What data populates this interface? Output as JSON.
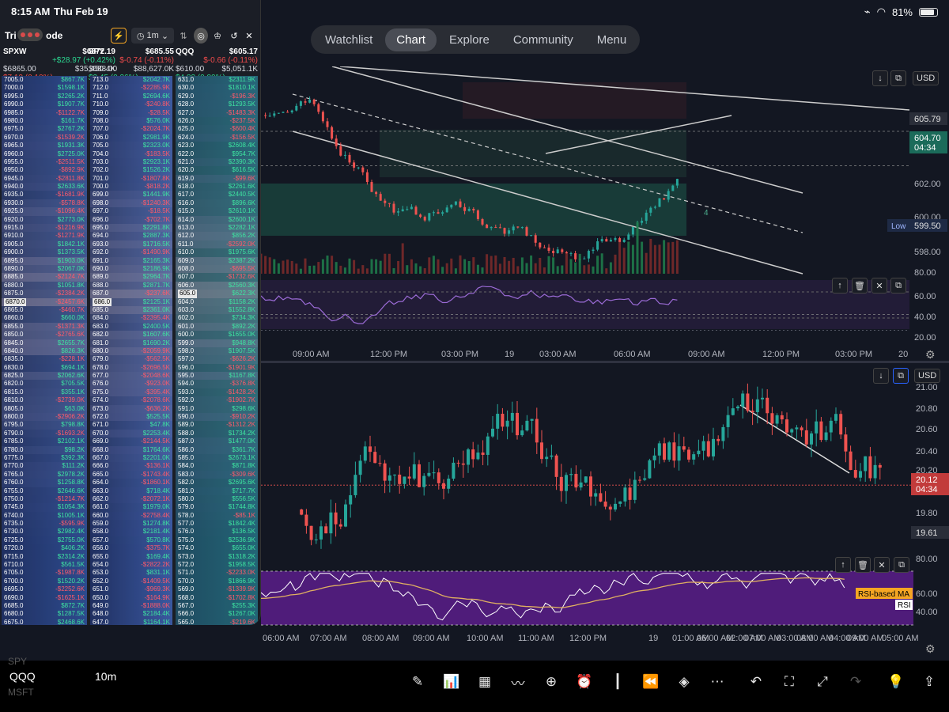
{
  "status": {
    "time": "8:15 AM",
    "date": "Thu Feb 19",
    "battery": "81%"
  },
  "tabs": [
    "Watchlist",
    "Chart",
    "Explore",
    "Community",
    "Menu"
  ],
  "ladder": {
    "title": "Tri",
    "title_suffix": "ode",
    "interval": "1m",
    "heads": [
      {
        "sym": "SPXW",
        "price": "$6872.19",
        "chg": "+$28.97 (+0.42%)",
        "l1": "$6865.00",
        "l2": "$35,450.4K",
        "l3": "$7.19 (0.10%)"
      },
      {
        "sym": "SPY",
        "price": "$685.55",
        "chg": "$-0.74 (-0.11%)",
        "l1": "$688.00",
        "l2": "$88,627.0K",
        "l3": "$2.45 (0.36%)"
      },
      {
        "sym": "QQQ",
        "price": "$605.17",
        "chg": "$-0.66 (-0.11%)",
        "l1": "$610.00",
        "l2": "$5,051.1K",
        "l3": "$4.83 (0.80%)"
      }
    ]
  },
  "chart_top": {
    "usd": "USD",
    "price_labels": [
      "605.79",
      "604.70",
      "04:34",
      "602.00",
      "600.00",
      "599.50",
      "598.00"
    ],
    "low_label": "Low",
    "rsi_labels": [
      "80.00",
      "60.00",
      "40.00",
      "20.00"
    ],
    "time_labels": [
      "09:00 AM",
      "12:00 PM",
      "03:00 PM",
      "19",
      "03:00 AM",
      "06:00 AM",
      "09:00 AM",
      "12:00 PM",
      "03:00 PM",
      "20"
    ],
    "annotation": "4"
  },
  "chart_bottom": {
    "usd": "USD",
    "price_labels": [
      "21.00",
      "20.80",
      "20.60",
      "20.40",
      "20.20",
      "20.12",
      "04:34",
      "19.80",
      "19.61"
    ],
    "rsi_labels": [
      "80.00",
      "60.00",
      "40.00"
    ],
    "rsi_ma_label": "RSI-based MA",
    "rsi_label": "RSI",
    "time_labels": [
      "06:00 AM",
      "07:00 AM",
      "08:00 AM",
      "09:00 AM",
      "10:00 AM",
      "11:00 AM",
      "12:00 PM",
      "19",
      "01:00 AM",
      "02:00 AM",
      "03:00 AM",
      "04:00 AM",
      "05:00 AM",
      "06:00 AM",
      "07:00 AM",
      "08:00 AM",
      "09:00 AM"
    ]
  },
  "bottombar": {
    "symbol": "QQQ",
    "interval": "10m",
    "ghost1": "SPY",
    "ghost2": "MSFT"
  },
  "colors": {
    "up": "#26a69a",
    "down": "#ef5350",
    "rsi_purple": "#7e57c2",
    "accent": "#f5a623"
  }
}
